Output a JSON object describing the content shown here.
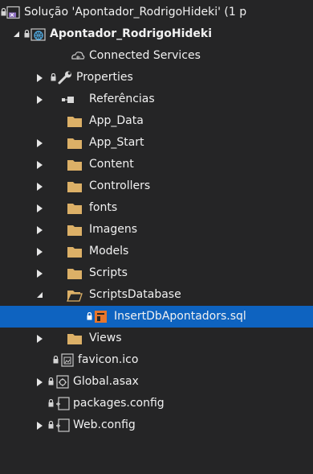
{
  "solution_explorer": {
    "solution_label": "Solução 'Apontador_RodrigoHideki' (1 p",
    "project_label": "Apontador_RodrigoHideki",
    "items": {
      "connected_services": "Connected Services",
      "properties": "Properties",
      "references": "Referências",
      "app_data": "App_Data",
      "app_start": "App_Start",
      "content": "Content",
      "controllers": "Controllers",
      "fonts": "fonts",
      "imagens": "Imagens",
      "models": "Models",
      "scripts": "Scripts",
      "scripts_database": "ScriptsDatabase",
      "insert_sql": "InsertDbApontadors.sql",
      "views": "Views",
      "favicon": "favicon.ico",
      "global_asax": "Global.asax",
      "packages_config": "packages.config",
      "web_config": "Web.config"
    },
    "selected_item": "InsertDbApontadors.sql",
    "colors": {
      "background": "#252526",
      "selection": "#0e63c0",
      "text": "#f1f1f1",
      "folder": "#dcb067",
      "sql_icon": "#e8762c"
    }
  }
}
